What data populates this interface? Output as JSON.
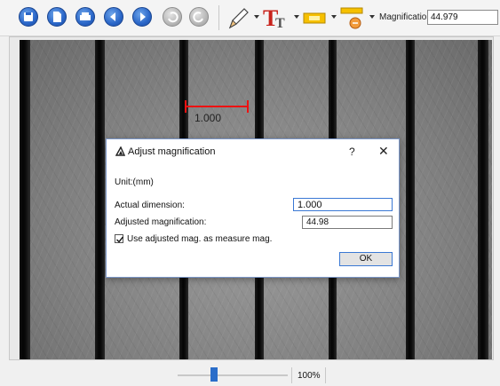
{
  "toolbar": {
    "buttons": [
      {
        "icon": "save-icon"
      },
      {
        "icon": "document-icon"
      },
      {
        "icon": "print-icon"
      },
      {
        "icon": "arrow-left-icon"
      },
      {
        "icon": "arrow-right-icon"
      },
      {
        "icon": "undo-icon"
      },
      {
        "icon": "redo-icon"
      }
    ],
    "tools": [
      {
        "icon": "pencil-icon"
      },
      {
        "icon": "text-tool-icon",
        "glyph": "T"
      },
      {
        "icon": "highlight-icon"
      },
      {
        "icon": "measure-tool-icon"
      }
    ],
    "magnification_label": "Magnification:",
    "magnification_value": "44.979",
    "accent": "#2a66c8"
  },
  "viewer": {
    "measurement_label": "1.000",
    "measurement_color": "#e11111"
  },
  "dialog": {
    "title": "Adjust magnification",
    "help": "?",
    "close": "✕",
    "unit_label": "Unit:(mm)",
    "actual_label": "Actual dimension:",
    "actual_value": "1.000",
    "adjusted_label": "Adjusted magnification:",
    "adjusted_value": "44.98",
    "checkbox_label": "Use adjusted mag. as measure mag.",
    "checkbox_checked": true,
    "ok_label": "OK"
  },
  "zoom": {
    "percent": "100%",
    "slider_level": 0.33
  }
}
